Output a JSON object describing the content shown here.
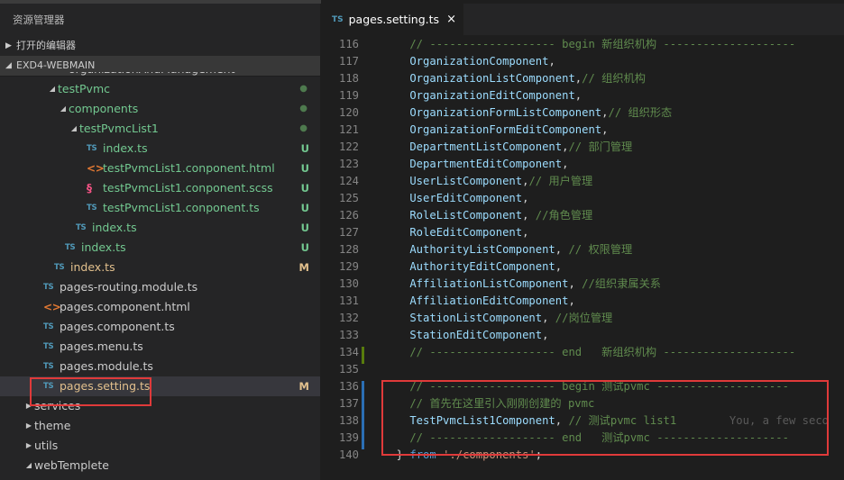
{
  "sidebar": {
    "title": "资源管理器",
    "open_editors": "打开的编辑器",
    "project": "EXD4-WEBMAIN"
  },
  "tree": [
    {
      "label": "organizationAndManagement",
      "indent": 0,
      "type": "folder-clipped",
      "badge": ""
    },
    {
      "label": "testPvmc",
      "type": "folder-open",
      "badge": "●",
      "badge_kind": "dot",
      "git": true
    },
    {
      "label": "components",
      "type": "folder-open",
      "badge": "●",
      "badge_kind": "dot",
      "git": true
    },
    {
      "label": "testPvmcList1",
      "type": "folder-open",
      "badge": "●",
      "badge_kind": "dot",
      "git": true
    },
    {
      "label": "index.ts",
      "type": "ts",
      "badge": "U",
      "badge_kind": "u",
      "git": true
    },
    {
      "label": "testPvmcList1.conponent.html",
      "type": "html",
      "badge": "U",
      "badge_kind": "u",
      "git": true
    },
    {
      "label": "testPvmcList1.conponent.scss",
      "type": "scss",
      "badge": "U",
      "badge_kind": "u",
      "git": true
    },
    {
      "label": "testPvmcList1.conponent.ts",
      "type": "ts",
      "badge": "U",
      "badge_kind": "u",
      "git": true
    },
    {
      "label": "index.ts",
      "type": "ts",
      "badge": "U",
      "badge_kind": "u",
      "git": true
    },
    {
      "label": "index.ts",
      "type": "ts",
      "badge": "U",
      "badge_kind": "u",
      "git": true
    },
    {
      "label": "index.ts",
      "type": "ts",
      "badge": "M",
      "badge_kind": "m",
      "mod": true
    },
    {
      "label": "pages-routing.module.ts",
      "type": "ts",
      "badge": ""
    },
    {
      "label": "pages.component.html",
      "type": "html",
      "badge": ""
    },
    {
      "label": "pages.component.ts",
      "type": "ts",
      "badge": ""
    },
    {
      "label": "pages.menu.ts",
      "type": "ts",
      "badge": ""
    },
    {
      "label": "pages.module.ts",
      "type": "ts",
      "badge": ""
    },
    {
      "label": "pages.setting.ts",
      "type": "ts",
      "badge": "M",
      "badge_kind": "m",
      "mod": true,
      "selected": true
    },
    {
      "label": "services",
      "type": "folder-closed",
      "badge": ""
    },
    {
      "label": "theme",
      "type": "folder-closed",
      "badge": ""
    },
    {
      "label": "utils",
      "type": "folder-closed",
      "badge": ""
    },
    {
      "label": "webTemplete",
      "type": "folder-open",
      "badge": ""
    }
  ],
  "editor": {
    "tab_label": "pages.setting.ts",
    "tab_icon": "TS",
    "close": "×",
    "lines": [
      {
        "n": "116",
        "parts": [
          [
            "cm",
            "    // ------------------- begin 新组织机构 --------------------"
          ]
        ]
      },
      {
        "n": "117",
        "parts": [
          [
            "id",
            "    OrganizationComponent"
          ],
          [
            "pl",
            ","
          ]
        ]
      },
      {
        "n": "118",
        "parts": [
          [
            "id",
            "    OrganizationListComponent"
          ],
          [
            "pl",
            ","
          ],
          [
            "cm",
            "// 组织机构"
          ]
        ]
      },
      {
        "n": "119",
        "parts": [
          [
            "id",
            "    OrganizationEditComponent"
          ],
          [
            "pl",
            ","
          ]
        ]
      },
      {
        "n": "120",
        "parts": [
          [
            "id",
            "    OrganizationFormListComponent"
          ],
          [
            "pl",
            ","
          ],
          [
            "cm",
            "// 组织形态"
          ]
        ]
      },
      {
        "n": "121",
        "parts": [
          [
            "id",
            "    OrganizationFormEditComponent"
          ],
          [
            "pl",
            ","
          ]
        ]
      },
      {
        "n": "122",
        "parts": [
          [
            "id",
            "    DepartmentListComponent"
          ],
          [
            "pl",
            ","
          ],
          [
            "cm",
            "// 部门管理"
          ]
        ]
      },
      {
        "n": "123",
        "parts": [
          [
            "id",
            "    DepartmentEditComponent"
          ],
          [
            "pl",
            ","
          ]
        ]
      },
      {
        "n": "124",
        "parts": [
          [
            "id",
            "    UserListComponent"
          ],
          [
            "pl",
            ","
          ],
          [
            "cm",
            "// 用户管理"
          ]
        ]
      },
      {
        "n": "125",
        "parts": [
          [
            "id",
            "    UserEditComponent"
          ],
          [
            "pl",
            ","
          ]
        ]
      },
      {
        "n": "126",
        "parts": [
          [
            "id",
            "    RoleListComponent"
          ],
          [
            "pl",
            ", "
          ],
          [
            "cm",
            "//角色管理"
          ]
        ]
      },
      {
        "n": "127",
        "parts": [
          [
            "id",
            "    RoleEditComponent"
          ],
          [
            "pl",
            ","
          ]
        ]
      },
      {
        "n": "128",
        "parts": [
          [
            "id",
            "    AuthorityListComponent"
          ],
          [
            "pl",
            ", "
          ],
          [
            "cm",
            "// 权限管理"
          ]
        ]
      },
      {
        "n": "129",
        "parts": [
          [
            "id",
            "    AuthorityEditComponent"
          ],
          [
            "pl",
            ","
          ]
        ]
      },
      {
        "n": "130",
        "parts": [
          [
            "id",
            "    AffiliationListComponent"
          ],
          [
            "pl",
            ", "
          ],
          [
            "cm",
            "//组织隶属关系"
          ]
        ]
      },
      {
        "n": "131",
        "parts": [
          [
            "id",
            "    AffiliationEditComponent"
          ],
          [
            "pl",
            ","
          ]
        ]
      },
      {
        "n": "132",
        "parts": [
          [
            "id",
            "    StationListComponent"
          ],
          [
            "pl",
            ", "
          ],
          [
            "cm",
            "//岗位管理"
          ]
        ]
      },
      {
        "n": "133",
        "parts": [
          [
            "id",
            "    StationEditComponent"
          ],
          [
            "pl",
            ","
          ]
        ]
      },
      {
        "n": "134",
        "parts": [
          [
            "cm",
            "    // ------------------- end   新组织机构 --------------------"
          ]
        ]
      },
      {
        "n": "135",
        "parts": []
      },
      {
        "n": "136",
        "parts": [
          [
            "cm",
            "    // ------------------- begin 测试pvmc --------------------"
          ]
        ]
      },
      {
        "n": "137",
        "parts": [
          [
            "cm",
            "    // 首先在这里引入刚刚创建的 pvmc"
          ]
        ]
      },
      {
        "n": "138",
        "parts": [
          [
            "id",
            "    TestPvmcList1Component"
          ],
          [
            "pl",
            ", "
          ],
          [
            "cm",
            "// 测试pvmc list1"
          ],
          [
            "blame",
            "        You, a few seco"
          ]
        ]
      },
      {
        "n": "139",
        "parts": [
          [
            "cm",
            "    // ------------------- end   测试pvmc --------------------"
          ]
        ]
      },
      {
        "n": "140",
        "parts": [
          [
            "pl",
            "  } "
          ],
          [
            "kw",
            "from"
          ],
          [
            "pl",
            " "
          ],
          [
            "str",
            "'./components'"
          ],
          [
            "pl",
            ";"
          ]
        ]
      }
    ]
  }
}
